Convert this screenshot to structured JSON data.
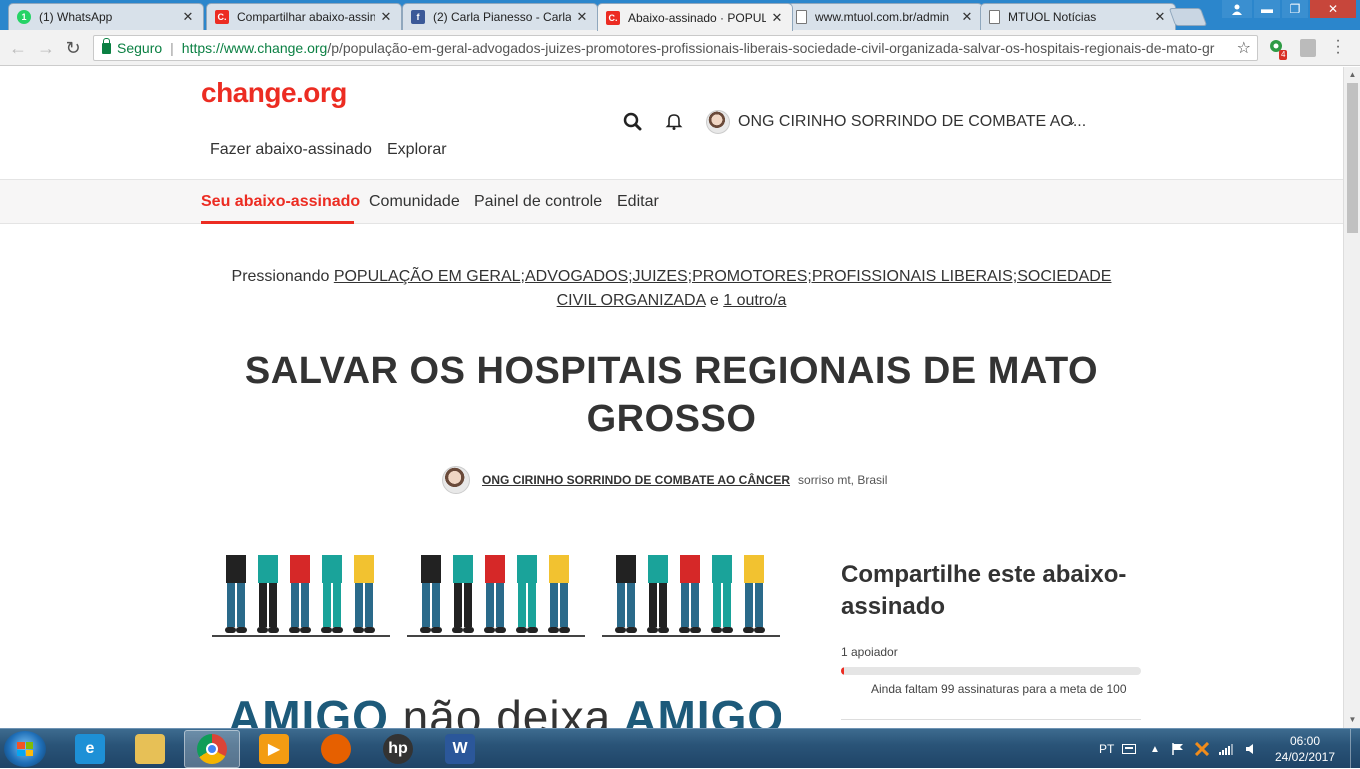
{
  "browser": {
    "tabs": [
      {
        "title": "(1) WhatsApp",
        "icon": "whatsapp-icon",
        "color": "#25d366",
        "glyph": "1"
      },
      {
        "title": "Compartilhar abaixo-assinado",
        "icon": "change-org-icon",
        "color": "#ec2c22",
        "glyph": "C."
      },
      {
        "title": "(2) Carla Pianesso - Carla",
        "icon": "facebook-icon",
        "color": "#3b5998",
        "glyph": "f"
      },
      {
        "title": "Abaixo-assinado · POPULAÇÃO",
        "icon": "change-org-icon",
        "color": "#ec2c22",
        "glyph": "C."
      },
      {
        "title": "www.mtuol.com.br/admin",
        "icon": "page-icon",
        "color": "#ffffff",
        "glyph": ""
      },
      {
        "title": "MTUOL Notícias",
        "icon": "page-icon",
        "color": "#ffffff",
        "glyph": ""
      }
    ],
    "active_tab": 3,
    "close_glyph": "✕",
    "secure_label": "Seguro",
    "url_host": "https://www.change.org",
    "url_path": "/p/população-em-geral-advogados-juizes-promotores-profissionais-liberais-sociedade-civil-organizada-salvar-os-hospitais-regionais-de-mato-gr",
    "extension_badge": "4"
  },
  "site": {
    "logo": "change.org",
    "nav": {
      "start_petition": "Fazer abaixo-assinado",
      "explore": "Explorar"
    },
    "user_name": "ONG CIRINHO SORRINDO DE COMBATE AO...",
    "subnav": {
      "your_petition": "Seu abaixo-assinado",
      "community": "Comunidade",
      "dashboard": "Painel de controle",
      "edit": "Editar"
    }
  },
  "petition": {
    "target_prefix": "Pressionando",
    "target_name": "POPULAÇÃO EM GERAL;ADVOGADOS;JUIZES;PROMOTORES;PROFISSIONAIS LIBERAIS;SOCIEDADE CIVIL ORGANIZADA",
    "target_and": "e",
    "target_more": "1 outro/a",
    "title": "SALVAR OS HOSPITAIS REGIONAIS DE MATO GROSSO",
    "author": "ONG CIRINHO SORRINDO DE COMBATE AO CÂNCER",
    "location": "sorriso mt, Brasil",
    "image_text_a": "AMIGO",
    "image_text_b": "não deixa",
    "image_text_c": "AMIGO"
  },
  "share": {
    "title": "Compartilhe este abaixo-assinado",
    "supporters": "1 apoiador",
    "progress_fraction": 0.01,
    "goal_text": "Ainda faltam 99 assinaturas para a meta de 100"
  },
  "taskbar": {
    "apps": [
      {
        "name": "internet-explorer",
        "glyph": "e",
        "color": "#1e90d6"
      },
      {
        "name": "file-explorer",
        "glyph": "",
        "color": "#e7c056"
      },
      {
        "name": "chrome",
        "glyph": "",
        "color": "#e53935"
      },
      {
        "name": "media-player",
        "glyph": "▶",
        "color": "#f39c12"
      },
      {
        "name": "firefox",
        "glyph": "",
        "color": "#e66000"
      },
      {
        "name": "hp",
        "glyph": "hp",
        "color": "#333333"
      },
      {
        "name": "word",
        "glyph": "W",
        "color": "#2b579a"
      }
    ],
    "active_app": 2,
    "language": "PT",
    "time": "06:00",
    "date": "24/02/2017"
  }
}
